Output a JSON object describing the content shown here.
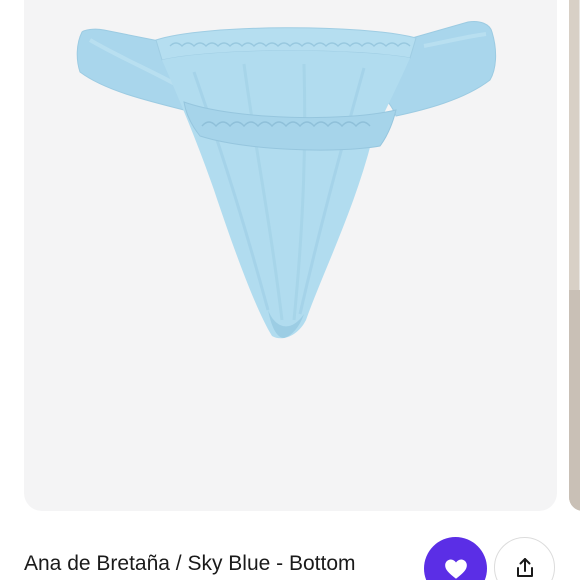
{
  "product": {
    "title": "Ana de Bretaña / Sky Blue - Bottom",
    "image_subject": "sky blue ruched bikini bottom",
    "color": "#add8ec"
  },
  "actions": {
    "like_icon": "heart-icon",
    "share_icon": "share-upload-icon"
  },
  "colors": {
    "accent": "#5b2ee6",
    "card_background": "#f4f4f5"
  }
}
